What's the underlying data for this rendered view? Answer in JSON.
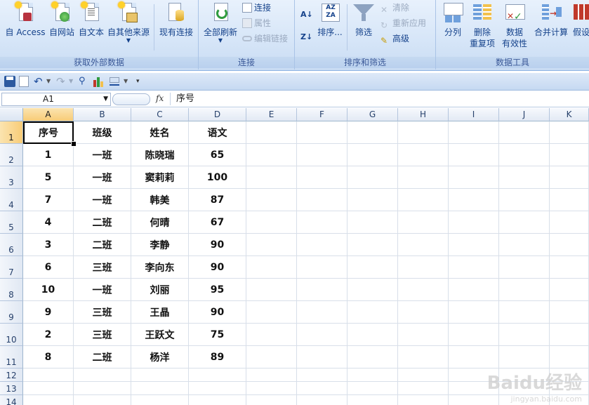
{
  "ribbon": {
    "groups": {
      "external_data": "获取外部数据",
      "connections": "连接",
      "sort_filter": "排序和筛选",
      "data_tools": "数据工具"
    },
    "buttons": {
      "from_access": "自 Access",
      "from_web": "自网站",
      "from_text": "自文本",
      "from_other": "自其他来源",
      "existing_connections": "现有连接",
      "refresh_all": "全部刷新",
      "connections": "连接",
      "properties": "属性",
      "edit_links": "编辑链接",
      "sort": "排序...",
      "filter": "筛选",
      "clear": "清除",
      "reapply": "重新应用",
      "advanced": "高级",
      "text_to_columns": "分列",
      "remove_duplicates_1": "删除",
      "remove_duplicates_2": "重复项",
      "data_validation_1": "数据",
      "data_validation_2": "有效性",
      "consolidate": "合并计算",
      "what_if": "假设"
    }
  },
  "formula_bar": {
    "name_box": "A1",
    "fx": "fx",
    "content": "序号"
  },
  "columns": [
    "A",
    "B",
    "C",
    "D",
    "E",
    "F",
    "G",
    "H",
    "I",
    "J",
    "K"
  ],
  "rows": [
    "1",
    "2",
    "3",
    "4",
    "5",
    "6",
    "7",
    "8",
    "9",
    "10",
    "11",
    "12",
    "13",
    "14"
  ],
  "table": {
    "header": [
      "序号",
      "班级",
      "姓名",
      "语文"
    ],
    "data": [
      [
        "1",
        "一班",
        "陈晓瑞",
        "65"
      ],
      [
        "5",
        "一班",
        "窦莉莉",
        "100"
      ],
      [
        "7",
        "一班",
        "韩美",
        "87"
      ],
      [
        "4",
        "二班",
        "何晴",
        "67"
      ],
      [
        "3",
        "二班",
        "李静",
        "90"
      ],
      [
        "6",
        "三班",
        "李向东",
        "90"
      ],
      [
        "10",
        "一班",
        "刘丽",
        "95"
      ],
      [
        "9",
        "三班",
        "王晶",
        "90"
      ],
      [
        "2",
        "三班",
        "王跃文",
        "75"
      ],
      [
        "8",
        "二班",
        "杨洋",
        "89"
      ]
    ]
  },
  "watermark": {
    "brand": "Baidu经验",
    "url": "jingyan.baidu.com"
  }
}
